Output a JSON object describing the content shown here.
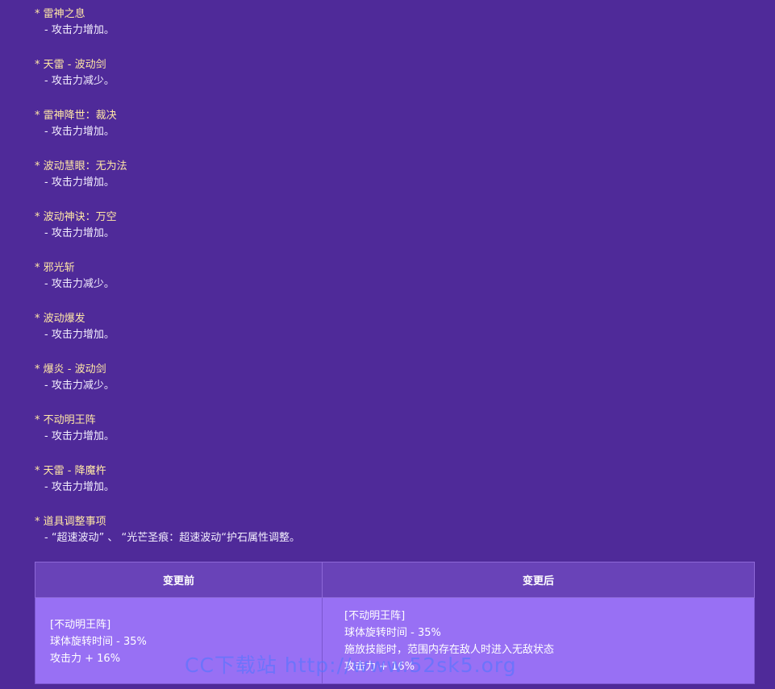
{
  "entries": [
    {
      "title": "* 雷神之息",
      "note": "- 攻击力增加。"
    },
    {
      "title": "* 天雷 - 波动剑",
      "note": "- 攻击力减少。"
    },
    {
      "title": "* 雷神降世：裁决",
      "note": "- 攻击力增加。"
    },
    {
      "title": "* 波动慧眼：无为法",
      "note": "- 攻击力增加。"
    },
    {
      "title": "* 波动神诀：万空",
      "note": "- 攻击力增加。"
    },
    {
      "title": "* 邪光斩",
      "note": "- 攻击力减少。"
    },
    {
      "title": "* 波动爆发",
      "note": "- 攻击力增加。"
    },
    {
      "title": "* 爆炎 - 波动剑",
      "note": "- 攻击力减少。"
    },
    {
      "title": "* 不动明王阵",
      "note": "- 攻击力增加。"
    },
    {
      "title": "* 天雷 - 降魔杵",
      "note": "- 攻击力增加。"
    },
    {
      "title": "* 道具调整事项",
      "note": "- “超速波动” 、 “光芒圣痕：超速波动“护石属性调整。"
    }
  ],
  "table": {
    "headers": [
      "变更前",
      "变更后"
    ],
    "before": [
      "[不动明王阵]",
      "球体旋转时间 - 35%",
      "攻击力 + 16%"
    ],
    "after": [
      "[不动明王阵]",
      "球体旋转时间 - 35%",
      "施放技能时，范围内存在敌人时进入无敌状态",
      "攻击力 + 16%"
    ]
  },
  "watermark": "CC下载站  http://www.52sk5.org",
  "colors": {
    "background": "#4f2a99",
    "title": "#ffe7a6",
    "note": "#f3eefe",
    "table_header": "#6943b8",
    "table_cell": "#9870f4",
    "watermark": "#5276ff"
  }
}
